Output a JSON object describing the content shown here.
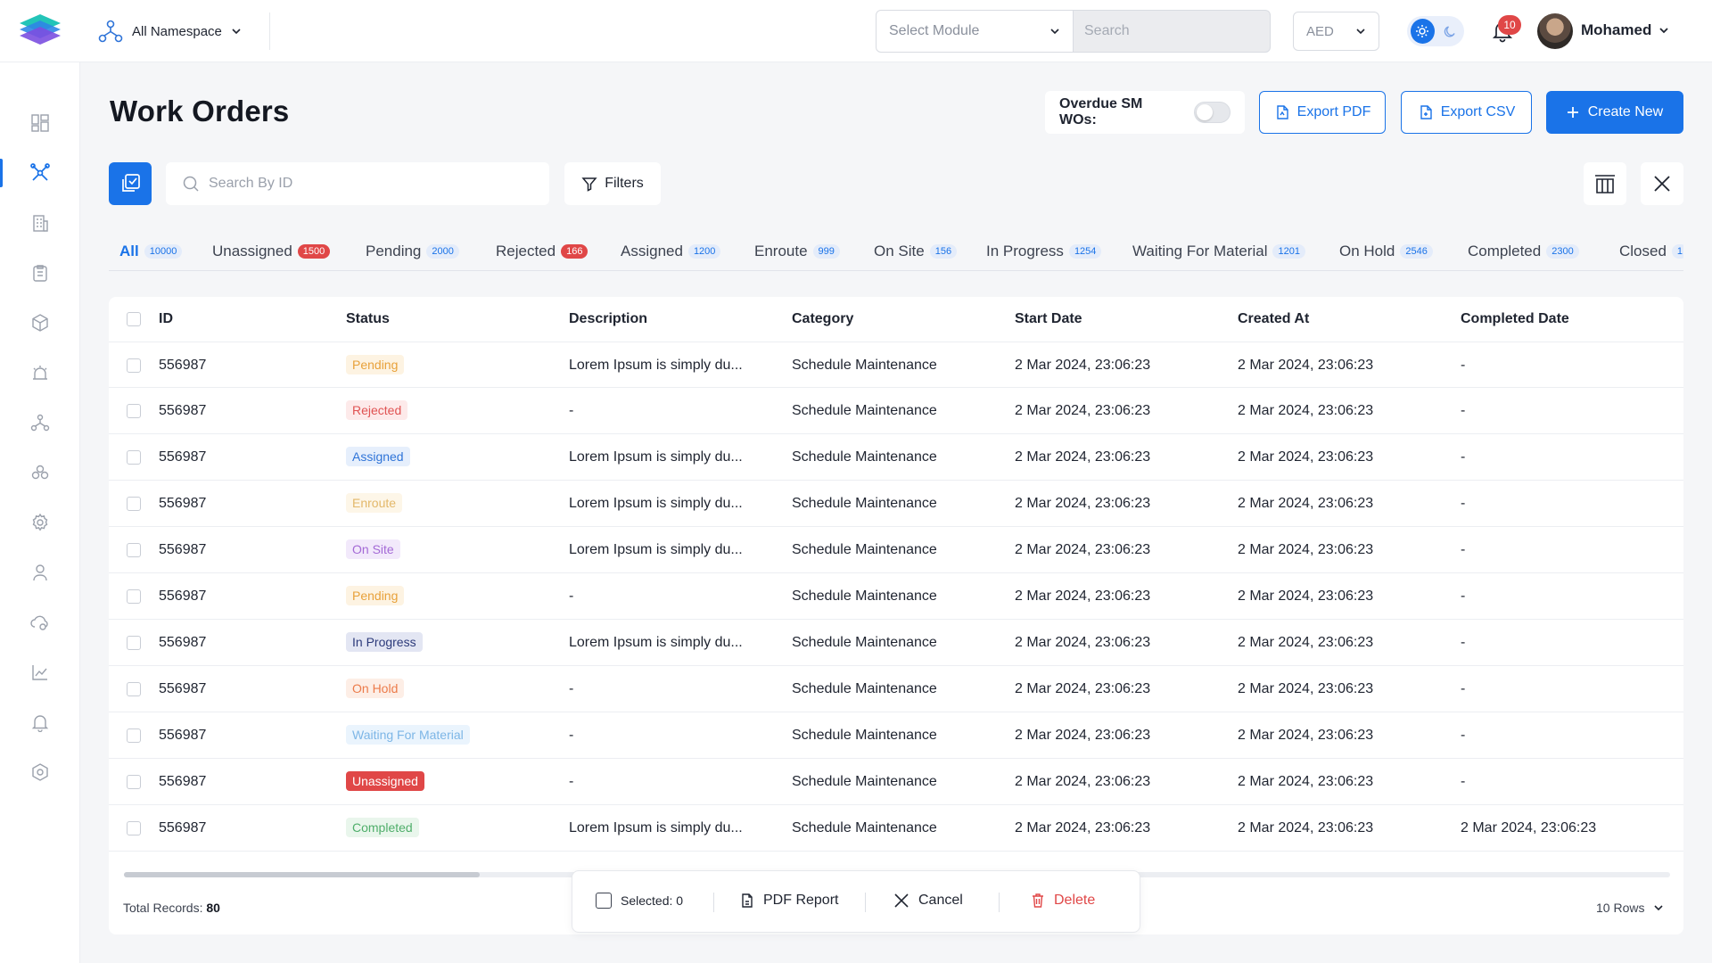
{
  "header": {
    "namespace_label": "All Namespace",
    "module_placeholder": "Select Module",
    "search_placeholder": "Search",
    "currency": "AED",
    "notification_count": "10",
    "user_name": "Mohamed"
  },
  "page": {
    "title": "Work Orders",
    "overdue_label": "Overdue SM WOs:",
    "overdue_enabled": false,
    "export_pdf_label": "Export PDF",
    "export_csv_label": "Export CSV",
    "create_label": "Create New",
    "search_by_id_placeholder": "Search By ID",
    "filters_label": "Filters"
  },
  "tabs": [
    {
      "label": "All",
      "count": "10000",
      "active": true
    },
    {
      "label": "Unassigned",
      "count": "1500",
      "emphasis": "red"
    },
    {
      "label": "Pending",
      "count": "2000"
    },
    {
      "label": "Rejected",
      "count": "166",
      "emphasis": "red"
    },
    {
      "label": "Assigned",
      "count": "1200"
    },
    {
      "label": "Enroute",
      "count": "999"
    },
    {
      "label": "On Site",
      "count": "156"
    },
    {
      "label": "In Progress",
      "count": "1254"
    },
    {
      "label": "Waiting For Material",
      "count": "1201"
    },
    {
      "label": "On Hold",
      "count": "2546"
    },
    {
      "label": "Completed",
      "count": "2300"
    },
    {
      "label": "Closed",
      "count": "1"
    }
  ],
  "table": {
    "columns": [
      "ID",
      "Status",
      "Description",
      "Category",
      "Start Date",
      "Created At",
      "Completed Date"
    ],
    "rows": [
      {
        "id": "556987",
        "status": "Pending",
        "description": "Lorem Ipsum is simply du...",
        "category": "Schedule Maintenance",
        "start": "2 Mar 2024, 23:06:23",
        "created": "2 Mar 2024, 23:06:23",
        "completed": "-"
      },
      {
        "id": "556987",
        "status": "Rejected",
        "description": "-",
        "category": "Schedule Maintenance",
        "start": "2 Mar 2024, 23:06:23",
        "created": "2 Mar 2024, 23:06:23",
        "completed": "-"
      },
      {
        "id": "556987",
        "status": "Assigned",
        "description": "Lorem Ipsum is simply du...",
        "category": "Schedule Maintenance",
        "start": "2 Mar 2024, 23:06:23",
        "created": "2 Mar 2024, 23:06:23",
        "completed": "-"
      },
      {
        "id": "556987",
        "status": "Enroute",
        "description": "Lorem Ipsum is simply du...",
        "category": "Schedule Maintenance",
        "start": "2 Mar 2024, 23:06:23",
        "created": "2 Mar 2024, 23:06:23",
        "completed": "-"
      },
      {
        "id": "556987",
        "status": "On Site",
        "description": "Lorem Ipsum is simply du...",
        "category": "Schedule Maintenance",
        "start": "2 Mar 2024, 23:06:23",
        "created": "2 Mar 2024, 23:06:23",
        "completed": "-"
      },
      {
        "id": "556987",
        "status": "Pending",
        "description": "-",
        "category": "Schedule Maintenance",
        "start": "2 Mar 2024, 23:06:23",
        "created": "2 Mar 2024, 23:06:23",
        "completed": "-"
      },
      {
        "id": "556987",
        "status": "In Progress",
        "description": "Lorem Ipsum is simply du...",
        "category": "Schedule Maintenance",
        "start": "2 Mar 2024, 23:06:23",
        "created": "2 Mar 2024, 23:06:23",
        "completed": "-"
      },
      {
        "id": "556987",
        "status": "On Hold",
        "description": "-",
        "category": "Schedule Maintenance",
        "start": "2 Mar 2024, 23:06:23",
        "created": "2 Mar 2024, 23:06:23",
        "completed": "-"
      },
      {
        "id": "556987",
        "status": "Waiting For Material",
        "description": "-",
        "category": "Schedule Maintenance",
        "start": "2 Mar 2024, 23:06:23",
        "created": "2 Mar 2024, 23:06:23",
        "completed": "-"
      },
      {
        "id": "556987",
        "status": "Unassigned",
        "description": "-",
        "category": "Schedule Maintenance",
        "start": "2 Mar 2024, 23:06:23",
        "created": "2 Mar 2024, 23:06:23",
        "completed": "-"
      },
      {
        "id": "556987",
        "status": "Completed",
        "description": "Lorem Ipsum is simply du...",
        "category": "Schedule Maintenance",
        "start": "2 Mar 2024, 23:06:23",
        "created": "2 Mar 2024, 23:06:23",
        "completed": "2 Mar 2024, 23:06:23"
      }
    ],
    "status_colors": {
      "Pending": {
        "bg": "#fdf3e2",
        "fg": "#e8a13a"
      },
      "Rejected": {
        "bg": "#fdeaea",
        "fg": "#e05353"
      },
      "Assigned": {
        "bg": "#e6effc",
        "fg": "#2f74d8"
      },
      "Enroute": {
        "bg": "#fdf6e8",
        "fg": "#e3b86a"
      },
      "On Site": {
        "bg": "#f2e9fb",
        "fg": "#a46ad6"
      },
      "In Progress": {
        "bg": "#e3e6f3",
        "fg": "#2c3a7a"
      },
      "On Hold": {
        "bg": "#fdeee6",
        "fg": "#ec7b4a"
      },
      "Waiting For Material": {
        "bg": "#eaf4fd",
        "fg": "#7db6e6"
      },
      "Unassigned": {
        "bg": "#e04747",
        "fg": "#ffffff"
      },
      "Completed": {
        "bg": "#e9f6ec",
        "fg": "#4fae6a"
      }
    },
    "total_label": "Total Records:",
    "total_value": "80",
    "rows_per_page": "10 Rows",
    "scroll_progress": 0.23
  },
  "actionbar": {
    "selected_label": "Selected: 0",
    "pdf_report_label": "PDF Report",
    "cancel_label": "Cancel",
    "delete_label": "Delete"
  },
  "colors": {
    "accent": "#1a73e8",
    "danger": "#e04747"
  }
}
